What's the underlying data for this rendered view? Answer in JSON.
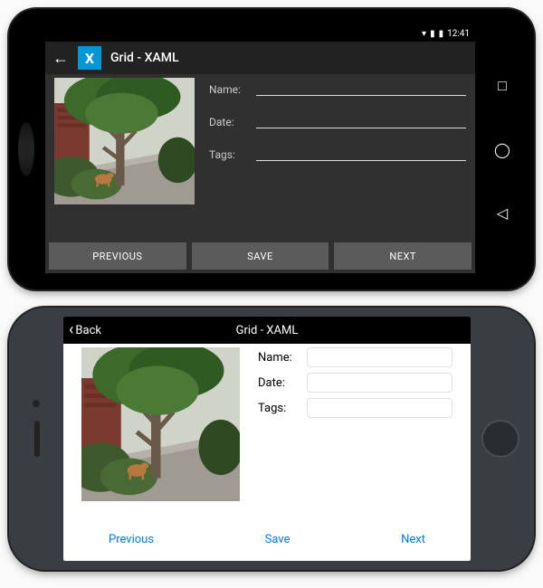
{
  "android": {
    "statusbar": {
      "time": "12:41"
    },
    "appbar": {
      "title": "Grid - XAML"
    },
    "form": {
      "name_label": "Name:",
      "date_label": "Date:",
      "tags_label": "Tags:",
      "name_value": "",
      "date_value": "",
      "tags_value": ""
    },
    "buttons": {
      "previous": "PREVIOUS",
      "save": "SAVE",
      "next": "NEXT"
    }
  },
  "ios": {
    "navbar": {
      "back": "Back",
      "title": "Grid - XAML"
    },
    "form": {
      "name_label": "Name:",
      "date_label": "Date:",
      "tags_label": "Tags:",
      "name_value": "",
      "date_value": "",
      "tags_value": ""
    },
    "buttons": {
      "previous": "Previous",
      "save": "Save",
      "next": "Next"
    }
  }
}
